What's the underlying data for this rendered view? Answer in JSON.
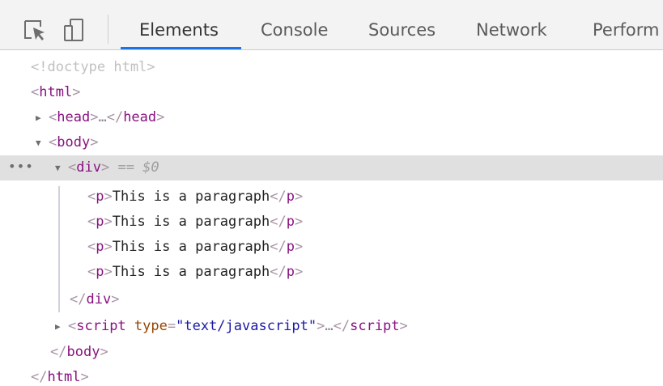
{
  "toolbar": {
    "inspect_icon": "inspect-element-icon",
    "device_icon": "device-toolbar-icon",
    "tabs": [
      {
        "label": "Elements",
        "active": true
      },
      {
        "label": "Console",
        "active": false
      },
      {
        "label": "Sources",
        "active": false
      },
      {
        "label": "Network",
        "active": false
      },
      {
        "label": "Perform",
        "active": false
      }
    ]
  },
  "tree": {
    "doctype": "<!doctype html>",
    "html_tag": "html",
    "head_tag": "head",
    "body_tag": "body",
    "div_tag": "div",
    "selected_marker": "== $0",
    "row_dots": "•••",
    "ellipsis": "…",
    "p_tag": "p",
    "paragraphs": [
      "This is a paragraph",
      "This is a paragraph",
      "This is a paragraph",
      "This is a paragraph"
    ],
    "script_tag": "script",
    "script_attr_name": "type",
    "script_attr_value": "\"text/javascript\""
  },
  "colors": {
    "accent": "#1a73e8",
    "tag": "#881280",
    "attr_name": "#994500",
    "attr_value": "#1a1aa6",
    "selected_row": "#e0e0e0"
  }
}
